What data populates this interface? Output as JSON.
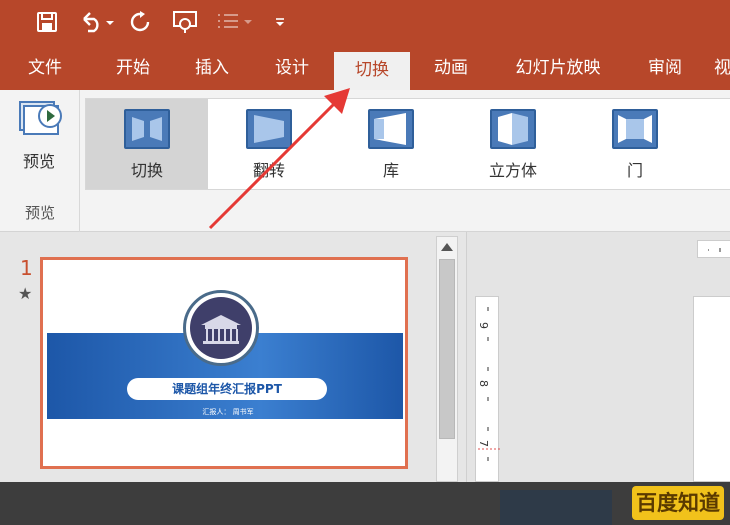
{
  "ribbon_tabs": [
    {
      "label": "文件"
    },
    {
      "label": "开始"
    },
    {
      "label": "插入"
    },
    {
      "label": "设计"
    },
    {
      "label": "切换"
    },
    {
      "label": "动画"
    },
    {
      "label": "幻灯片放映"
    },
    {
      "label": "审阅"
    },
    {
      "label": "视"
    }
  ],
  "active_tab": "切换",
  "preview": {
    "button_label": "预览",
    "group_label": "预览"
  },
  "gallery": [
    {
      "label": "切换",
      "selected": true
    },
    {
      "label": "翻转",
      "selected": false
    },
    {
      "label": "库",
      "selected": false
    },
    {
      "label": "立方体",
      "selected": false
    },
    {
      "label": "门",
      "selected": false
    }
  ],
  "slide_pane": {
    "slide_number": "1",
    "slide_title": "课题组年终汇报PPT",
    "reporter_text": "汇报人： 周书军"
  },
  "ruler_numbers": [
    "9",
    "8",
    "7"
  ],
  "watermark": "百度知道",
  "colors": {
    "accent": "#b7472a",
    "slide_band": "#1d57a8",
    "arrow": "#e53935"
  },
  "icons": {
    "save": "save-icon",
    "undo": "undo-icon",
    "redo": "redo-icon",
    "present": "present-icon",
    "list": "list-icon",
    "customize": "customize-icon"
  }
}
